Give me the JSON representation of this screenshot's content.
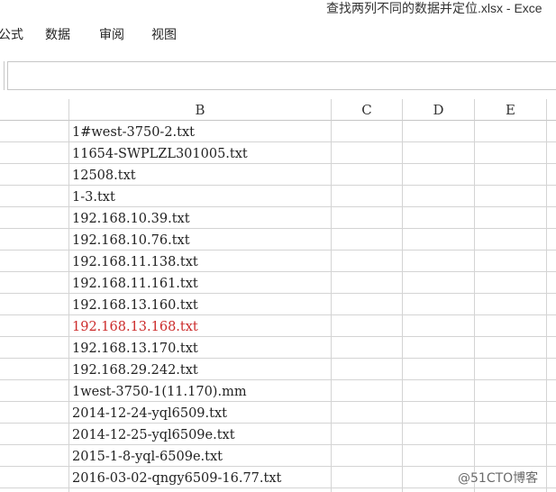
{
  "window": {
    "title": "查找两列不同的数据并定位.xlsx - Exce"
  },
  "ribbon_tabs": [
    {
      "label": "公式"
    },
    {
      "label": "数据"
    },
    {
      "label": "审阅"
    },
    {
      "label": "视图"
    }
  ],
  "formula_bar": {
    "value": ""
  },
  "columns": [
    "B",
    "C",
    "D",
    "E"
  ],
  "rows": [
    {
      "b": "1#west-3750-2.txt"
    },
    {
      "b": "11654-SWPLZL301005.txt"
    },
    {
      "b": "12508.txt"
    },
    {
      "b": "1-3.txt"
    },
    {
      "b": "192.168.10.39.txt"
    },
    {
      "b": "192.168.10.76.txt"
    },
    {
      "b": "192.168.11.138.txt"
    },
    {
      "b": "192.168.11.161.txt"
    },
    {
      "b": "192.168.13.160.txt"
    },
    {
      "b": "192.168.13.168.txt",
      "color": "#cc2b2b"
    },
    {
      "b": "192.168.13.170.txt"
    },
    {
      "b": "192.168.29.242.txt"
    },
    {
      "b": "1west-3750-1(11.170).mm"
    },
    {
      "b": "2014-12-24-yql6509.txt"
    },
    {
      "b": "2014-12-25-yql6509e.txt"
    },
    {
      "b": "2015-1-8-yql-6509e.txt"
    },
    {
      "b": "2016-03-02-qngy6509-16.77.txt"
    }
  ],
  "watermark": "@51CTO博客"
}
